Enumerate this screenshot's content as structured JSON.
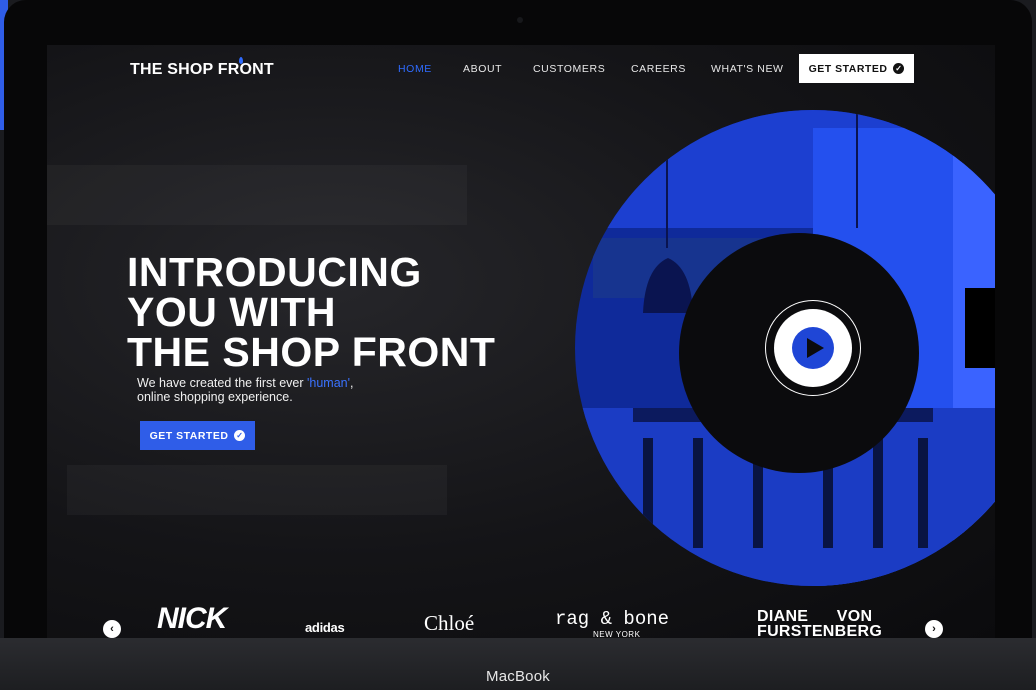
{
  "window": {
    "device_label": "MacBook"
  },
  "nav": {
    "logo": "THE SHOP FRONT",
    "items": [
      {
        "label": "HOME",
        "active": true
      },
      {
        "label": "ABOUT",
        "active": false
      },
      {
        "label": "CUSTOMERS",
        "active": false
      },
      {
        "label": "CAREERS",
        "active": false
      },
      {
        "label": "WHAT'S NEW",
        "active": false
      }
    ],
    "cta": "GET STARTED"
  },
  "hero": {
    "title_lines": [
      "INTRODUCING",
      "YOU WITH",
      "THE SHOP FRONT"
    ],
    "subtitle_before": "We have created the first ever ",
    "subtitle_highlight": "'human'",
    "subtitle_after": ",",
    "subtitle_line2": "online shopping experience.",
    "cta": "GET STARTED"
  },
  "media": {
    "play_icon": "play-icon"
  },
  "brands": {
    "items": [
      "NICK",
      "adidas",
      "Chloé",
      "rag & bone",
      "DIANE VON FURSTENBERG"
    ],
    "rag_sub": "NEW YORK",
    "dvf_line1": "DIANE",
    "dvf_line1b": "VON",
    "dvf_line2": "FURSTENBERG"
  },
  "colors": {
    "accent": "#2f5de8",
    "accent_text": "#3a72ff",
    "background": "#0d0d10"
  }
}
